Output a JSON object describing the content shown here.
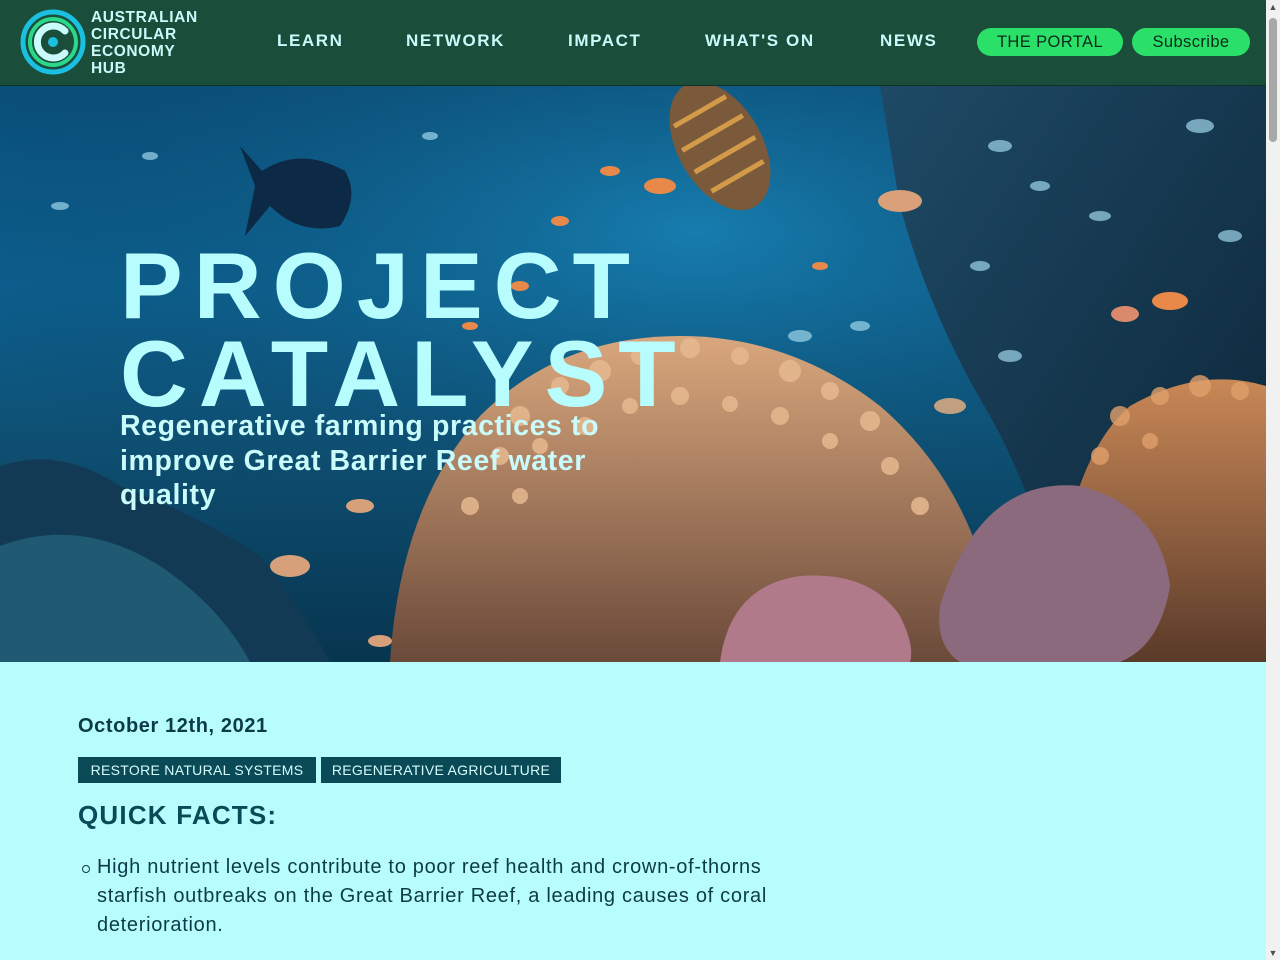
{
  "header": {
    "logo_icon": "circular-c-logo",
    "logo_lines": [
      "AUSTRALIAN",
      "CIRCULAR",
      "ECONOMY",
      "HUB"
    ],
    "nav": [
      "LEARN",
      "NETWORK",
      "IMPACT",
      "WHAT'S ON",
      "NEWS"
    ],
    "portal_label": "THE PORTAL",
    "subscribe_label": "Subscribe"
  },
  "hero": {
    "title_lines": [
      "PROJECT",
      "CATALYST"
    ],
    "subtitle": "Regenerative farming practices to improve Great Barrier Reef water quality",
    "image": "coral-reef-with-fish"
  },
  "article": {
    "date": "October 12th, 2021",
    "tags": [
      "RESTORE NATURAL SYSTEMS",
      "REGENERATIVE AGRICULTURE"
    ],
    "facts_heading": "QUICK FACTS:",
    "facts": [
      "High nutrient levels contribute to poor reef health and crown-of-thorns starfish outbreaks on the Great Barrier Reef, a leading causes of coral deterioration."
    ]
  },
  "colors": {
    "header_bg": "#1a4d3a",
    "page_bg": "#b8fdfd",
    "accent_green": "#2be068",
    "tag_bg": "#0a4a56",
    "hero_title": "#b8fdfd"
  },
  "scrollbar": {
    "up_icon": "triangle-up-icon",
    "down_icon": "triangle-down-icon"
  }
}
